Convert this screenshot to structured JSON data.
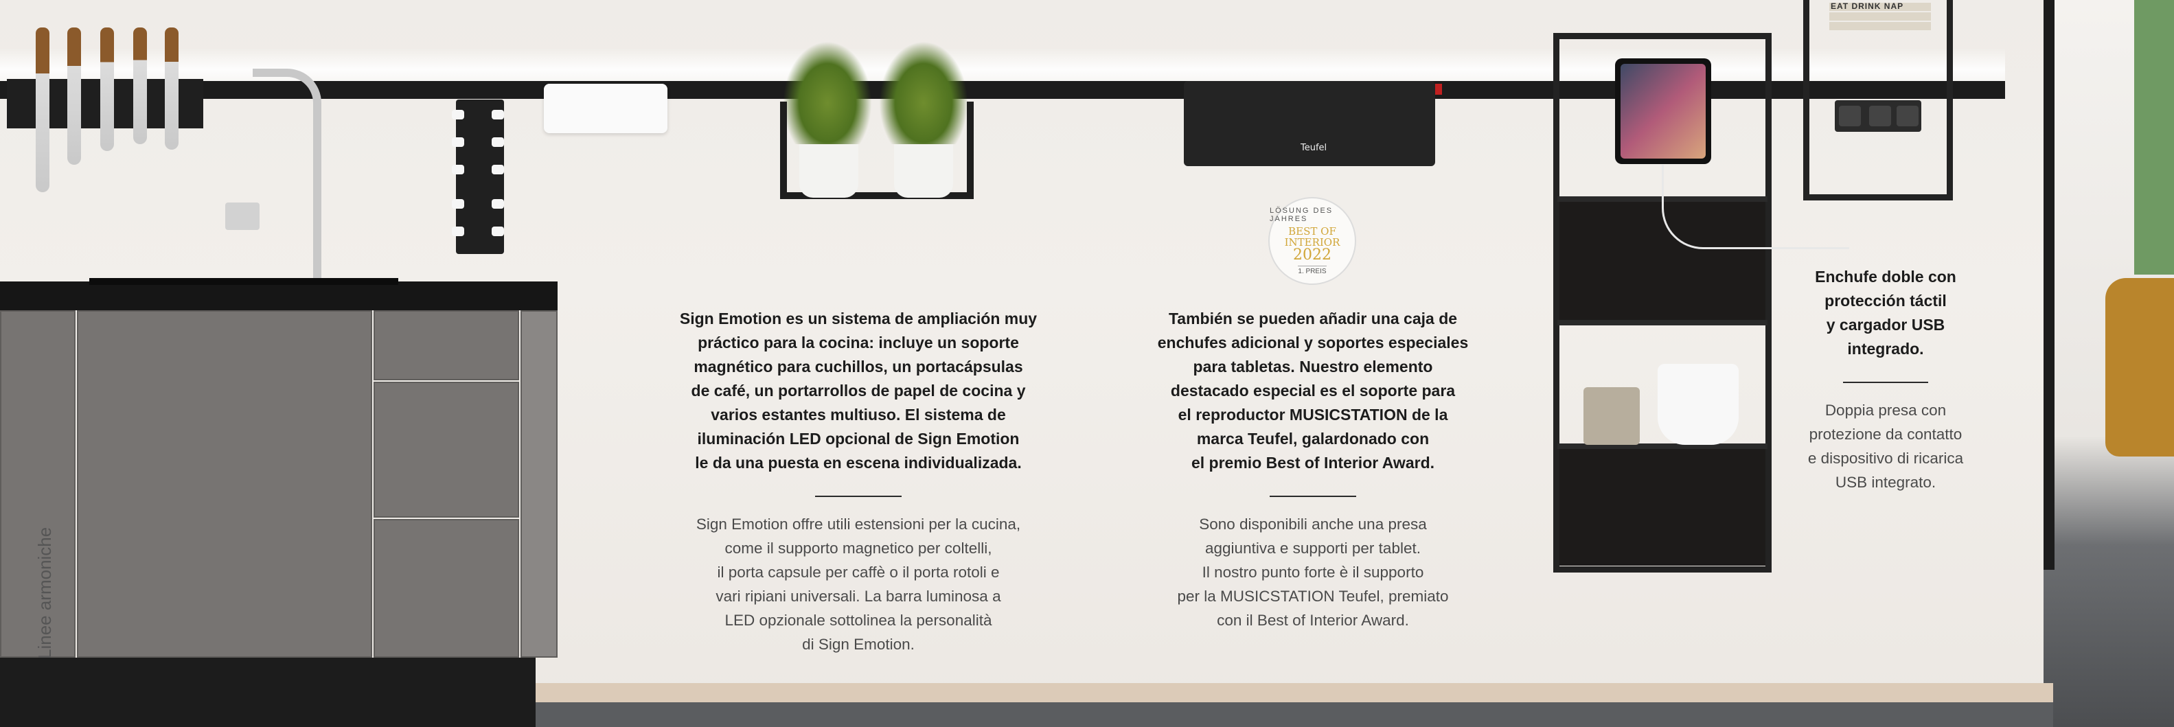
{
  "side_text": "Linee armoniche",
  "badge": {
    "top": "LÖSUNG DES JAHRES",
    "main_line1": "BEST OF",
    "main_line2": "INTERIOR",
    "year": "2022",
    "bottom": "1. PREIS"
  },
  "speaker_brand": "Teufel",
  "book_label": "EAT DRINK NAP",
  "block1": {
    "es_lines": [
      "Sign Emotion es un sistema de ampliación muy",
      "práctico para la cocina: incluye un soporte",
      "magnético para cuchillos, un portacápsulas",
      "de café, un portarrollos de papel de cocina y",
      "varios estantes multiuso. El sistema de",
      "iluminación LED opcional de Sign Emotion",
      "le da una puesta en escena individualizada."
    ],
    "it_lines": [
      "Sign Emotion offre utili estensioni per la cucina,",
      "come il supporto magnetico per coltelli,",
      "il porta capsule per caffè o il porta rotoli e",
      "vari ripiani universali. La barra luminosa a",
      "LED opzionale sottolinea la personalità",
      "di Sign Emotion."
    ]
  },
  "block2": {
    "es_lines": [
      "También se pueden añadir una caja de",
      "enchufes adicional y soportes especiales",
      "para tabletas. Nuestro elemento",
      "destacado especial es el soporte para",
      "el reproductor MUSICSTATION de la",
      "marca Teufel, galardonado con",
      "el premio Best of Interior Award."
    ],
    "it_lines": [
      "Sono disponibili anche una presa",
      "aggiuntiva e supporti per tablet.",
      "Il nostro punto forte è il supporto",
      "per la MUSICSTATION Teufel, premiato",
      "con il Best of Interior Award."
    ]
  },
  "block3": {
    "es_lines": [
      "Enchufe doble con",
      "protección táctil",
      "y cargador USB",
      "integrado."
    ],
    "it_lines": [
      "Doppia presa con",
      "protezione da contatto",
      "e dispositivo di ricarica",
      "USB integrato."
    ]
  }
}
